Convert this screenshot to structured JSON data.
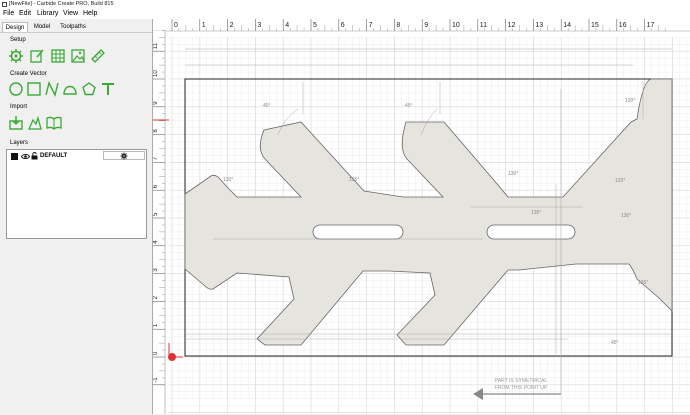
{
  "window": {
    "title": "[NewFile] - Carbide Create PRO, Build 815"
  },
  "menu": {
    "file": "File",
    "edit": "Edit",
    "library": "Library",
    "view": "View",
    "help": "Help"
  },
  "tabs": {
    "design": "Design",
    "model": "Model",
    "toolpaths": "Toolpaths"
  },
  "sections": {
    "setup": "Setup",
    "create_vector": "Create Vector",
    "import": "Import",
    "layers": "Layers"
  },
  "layers": [
    {
      "name": "DEFAULT",
      "color": "#111111"
    }
  ],
  "layer_settings_icon": "gear-icon",
  "ruler_top": [
    "0",
    "1",
    "2",
    "3",
    "4",
    "5",
    "6",
    "7",
    "8",
    "9",
    "10",
    "11",
    "12",
    "13",
    "14",
    "15",
    "16",
    "17"
  ],
  "ruler_left": [
    "11",
    "10",
    "9",
    "8",
    "7",
    "6",
    "5",
    "4",
    "3",
    "2",
    "1",
    "0",
    "-1"
  ],
  "note": [
    "PART IS SYMETRICAL",
    "FROM THIS POINT UP"
  ],
  "angles": [
    "45°",
    "45°",
    "135°",
    "130°",
    "120°",
    "130°",
    "135°",
    "120°",
    "130°",
    "135°",
    "45°"
  ],
  "colors": {
    "accent": "#3aaa35",
    "part_fill": "#e6e4df",
    "grid": "#dddddd"
  }
}
